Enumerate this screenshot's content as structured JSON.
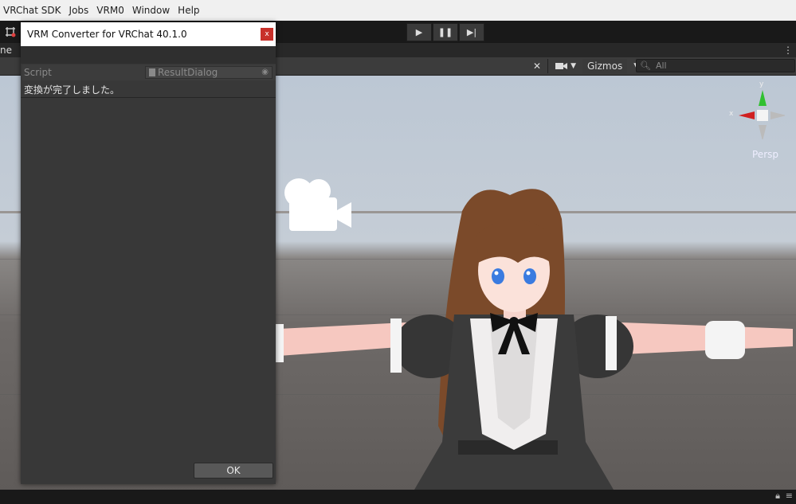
{
  "menu": {
    "items": [
      "VRChat SDK",
      "Jobs",
      "VRM0",
      "Window",
      "Help"
    ]
  },
  "toolbar": {
    "play_label": "▶",
    "pause_label": "❚❚",
    "step_label": "▶|"
  },
  "tabs": {
    "partial_tab_label": "ne"
  },
  "scene_header": {
    "gizmos_label": "Gizmos",
    "search_placeholder": "All"
  },
  "scene": {
    "projection_label": "Persp",
    "axis_x_label": "x",
    "axis_y_label": "y"
  },
  "dialog": {
    "title": "VRM Converter for VRChat 40.1.0",
    "close_label": "x",
    "script_label": "Script",
    "script_value": "ResultDialog",
    "message": "変換が完了しました。",
    "ok_label": "OK"
  },
  "colors": {
    "close_button": "#c8302a",
    "editor_dark": "#383838",
    "axis_x": "#d02020",
    "axis_y": "#30c030"
  }
}
